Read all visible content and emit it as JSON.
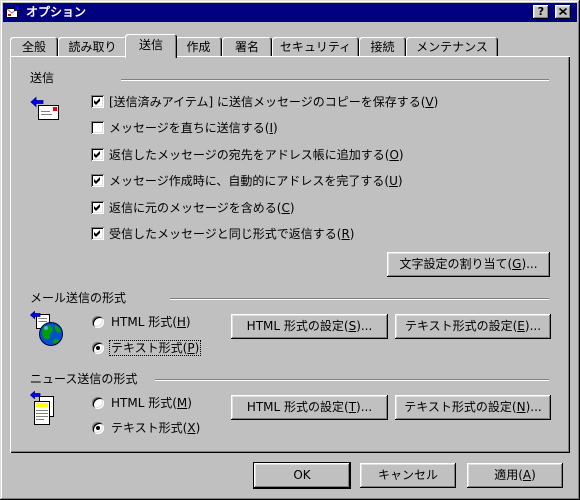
{
  "window": {
    "title": "オプション",
    "help_button_label": "?",
    "app_icon": "mail-options-icon"
  },
  "colors": {
    "dialog_face": "#c0c0c0",
    "title_bar": "#000080",
    "title_text": "#ffffff"
  },
  "tabs": [
    {
      "label": "全般",
      "selected": false
    },
    {
      "label": "読み取り",
      "selected": false
    },
    {
      "label": "送信",
      "selected": true
    },
    {
      "label": "作成",
      "selected": false
    },
    {
      "label": "署名",
      "selected": false
    },
    {
      "label": "セキュリティ",
      "selected": false
    },
    {
      "label": "接続",
      "selected": false
    },
    {
      "label": "メンテナンス",
      "selected": false
    }
  ],
  "send_section": {
    "heading": "送信",
    "icon": "send-mail-icon",
    "options": [
      {
        "label": "[送信済みアイテム] に送信メッセージのコピーを保存する(V)",
        "checked": true
      },
      {
        "label": "メッセージを直ちに送信する(I)",
        "checked": false
      },
      {
        "label": "返信したメッセージの宛先をアドレス帳に追加する(O)",
        "checked": true
      },
      {
        "label": "メッセージ作成時に、自動的にアドレスを完了する(U)",
        "checked": true
      },
      {
        "label": "返信に元のメッセージを含める(C)",
        "checked": true
      },
      {
        "label": "受信したメッセージと同じ形式で返信する(R)",
        "checked": true
      }
    ],
    "charset_button_label": "文字設定の割り当て(G)..."
  },
  "mail_format": {
    "heading": "メール送信の形式",
    "icon": "internet-mail-globe-icon",
    "options": [
      {
        "label": "HTML 形式(H)",
        "selected": false
      },
      {
        "label": "テキスト形式(P)",
        "selected": true
      }
    ],
    "html_settings_button_label": "HTML 形式の設定(S)...",
    "text_settings_button_label": "テキスト形式の設定(E)..."
  },
  "news_format": {
    "heading": "ニュース送信の形式",
    "icon": "news-article-icon",
    "options": [
      {
        "label": "HTML 形式(M)",
        "selected": false
      },
      {
        "label": "テキスト形式(X)",
        "selected": true
      }
    ],
    "html_settings_button_label": "HTML 形式の設定(T)...",
    "text_settings_button_label": "テキスト形式の設定(N)..."
  },
  "footer": {
    "ok_label": "OK",
    "cancel_label": "キャンセル",
    "apply_label": "適用(A)"
  }
}
